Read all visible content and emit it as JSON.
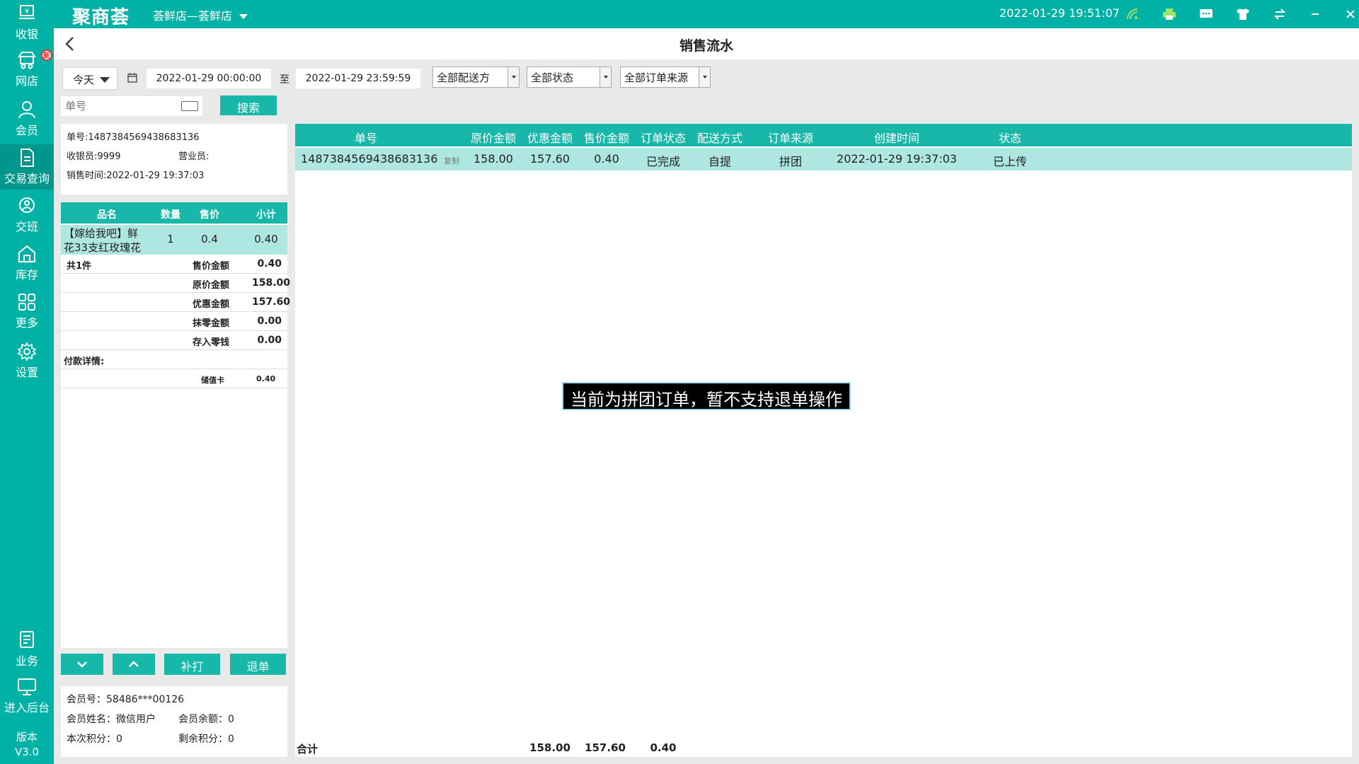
{
  "topbar": {
    "logo": "聚商荟",
    "store": "荟鲜店—荟鲜店",
    "datetime": "2022-01-29 19:51:07"
  },
  "sidebar": {
    "items": [
      {
        "label": "收银",
        "icon": "cashier-icon"
      },
      {
        "label": "网店",
        "icon": "online-store-icon",
        "badge": "新"
      },
      {
        "label": "会员",
        "icon": "member-icon"
      },
      {
        "label": "交易查询",
        "icon": "transaction-query-icon"
      },
      {
        "label": "交班",
        "icon": "shift-handover-icon"
      },
      {
        "label": "库存",
        "icon": "inventory-icon"
      },
      {
        "label": "更多",
        "icon": "more-grid-icon"
      },
      {
        "label": "设置",
        "icon": "settings-gear-icon"
      },
      {
        "label": "业务",
        "icon": "business-icon"
      },
      {
        "label": "进入后台",
        "icon": "backend-monitor-icon"
      }
    ],
    "version_label": "版本",
    "version": "V3.0"
  },
  "page": {
    "title": "销售流水"
  },
  "filters": {
    "date_preset": "今天",
    "start": "2022-01-29 00:00:00",
    "to": "至",
    "end": "2022-01-29 23:59:59",
    "delivery": "全部配送方",
    "status": "全部状态",
    "source": "全部订单来源",
    "search_placeholder": "单号",
    "search_button": "搜索"
  },
  "order_info": {
    "order_no": "单号:1487384569438683136",
    "cashier": "收银员:9999",
    "clerk": "营业员:",
    "sale_time": "销售时间:2022-01-29 19:37:03"
  },
  "detail": {
    "headers": [
      "品名",
      "数量",
      "售价",
      "小计"
    ],
    "item": {
      "name_line1": "【嫁给我吧】鲜",
      "name_line2": "花33支红玫瑰花",
      "qty": "1",
      "price": "0.4",
      "subtotal": "0.40"
    },
    "total_count": "共1件",
    "summary": [
      {
        "label": "售价金额",
        "value": "0.40"
      },
      {
        "label": "原价金额",
        "value": "158.00"
      },
      {
        "label": "优惠金额",
        "value": "157.60"
      },
      {
        "label": "抹零金额",
        "value": "0.00"
      },
      {
        "label": "存入零钱",
        "value": "0.00"
      }
    ],
    "payment_label": "付款详情:",
    "payment": {
      "method": "储值卡",
      "amount": "0.40"
    },
    "reprint": "补打",
    "refund": "退单"
  },
  "member": {
    "id": "会员号：58486***00126",
    "name": "会员姓名：微信用户",
    "balance": "会员余额：0",
    "points_now": "本次积分：0",
    "points_left": "剩余积分：0"
  },
  "table": {
    "headers": [
      "单号",
      "原价金额",
      "优惠金额",
      "售价金额",
      "订单状态",
      "配送方式",
      "订单来源",
      "创建时间",
      "状态"
    ],
    "rows": [
      {
        "order_no": "1487384569438683136",
        "copy": "复制",
        "original": "158.00",
        "discount": "157.60",
        "sale": "0.40",
        "order_status": "已完成",
        "delivery": "自提",
        "source": "拼团",
        "created": "2022-01-29 19:37:03",
        "status": "已上传"
      }
    ],
    "footer": {
      "label": "合计",
      "original": "158.00",
      "discount": "157.60",
      "sale": "0.40"
    }
  },
  "toast": "当前为拼团订单，暂不支持退单操作",
  "colors": {
    "accent": "#00b1a6",
    "row_highlight": "#aee7e2"
  }
}
